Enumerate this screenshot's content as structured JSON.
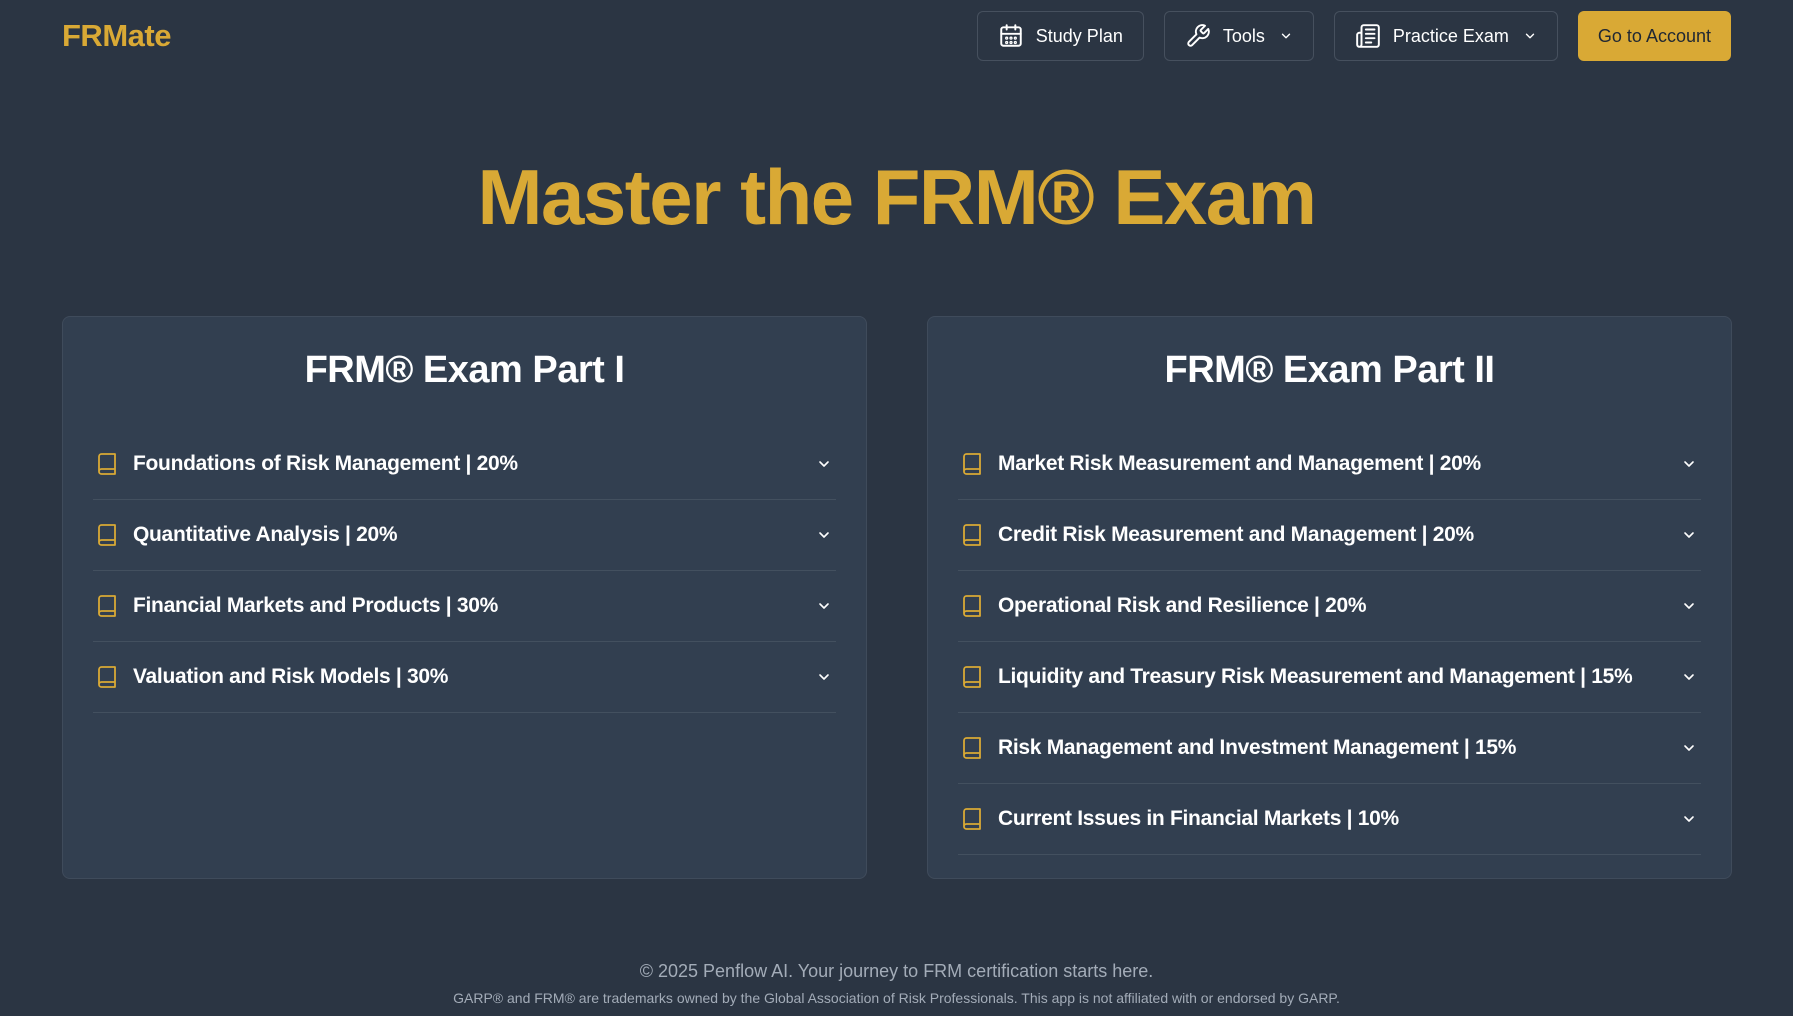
{
  "header": {
    "logo": "FRMate",
    "nav": {
      "study_plan": "Study Plan",
      "tools": "Tools",
      "practice_exam": "Practice Exam",
      "account": "Go to Account"
    }
  },
  "hero": {
    "title": "Master the FRM® Exam"
  },
  "part1": {
    "title": "FRM® Exam Part I",
    "topics": [
      "Foundations of Risk Management | 20%",
      "Quantitative Analysis | 20%",
      "Financial Markets and Products | 30%",
      "Valuation and Risk Models | 30%"
    ]
  },
  "part2": {
    "title": "FRM® Exam Part II",
    "topics": [
      "Market Risk Measurement and Management | 20%",
      "Credit Risk Measurement and Management | 20%",
      "Operational Risk and Resilience | 20%",
      "Liquidity and Treasury Risk Measurement and Management | 15%",
      "Risk Management and Investment Management | 15%",
      "Current Issues in Financial Markets | 10%"
    ]
  },
  "footer": {
    "copyright": "© 2025 Penflow AI. Your journey to FRM certification starts here.",
    "disclaimer": "GARP® and FRM® are trademarks owned by the Global Association of Risk Professionals. This app is not affiliated with or endorsed by GARP."
  },
  "colors": {
    "background": "#2b3543",
    "card": "#323f50",
    "accent": "#d9a935",
    "muted_text": "#a3acb8"
  },
  "icons": {
    "study_plan": "calendar-icon",
    "tools": "wrench-icon",
    "practice_exam": "newspaper-icon",
    "topic": "book-icon",
    "expand": "chevron-down-icon"
  }
}
